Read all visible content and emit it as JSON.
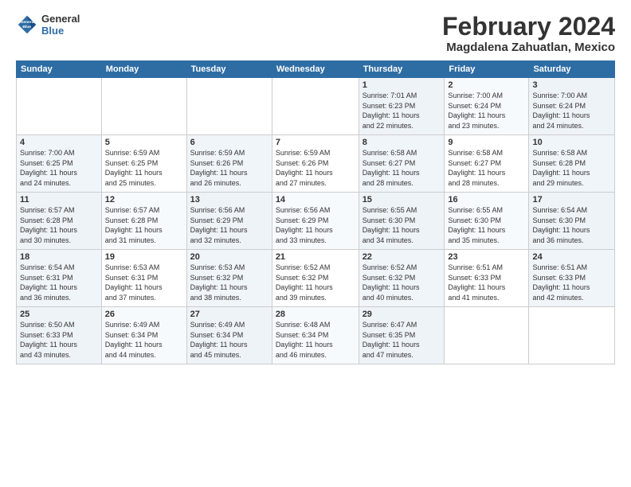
{
  "header": {
    "logo_line1": "General",
    "logo_line2": "Blue",
    "title": "February 2024",
    "subtitle": "Magdalena Zahuatlan, Mexico"
  },
  "calendar": {
    "days_of_week": [
      "Sunday",
      "Monday",
      "Tuesday",
      "Wednesday",
      "Thursday",
      "Friday",
      "Saturday"
    ],
    "weeks": [
      [
        {
          "day": "",
          "info": ""
        },
        {
          "day": "",
          "info": ""
        },
        {
          "day": "",
          "info": ""
        },
        {
          "day": "",
          "info": ""
        },
        {
          "day": "1",
          "info": "Sunrise: 7:01 AM\nSunset: 6:23 PM\nDaylight: 11 hours\nand 22 minutes."
        },
        {
          "day": "2",
          "info": "Sunrise: 7:00 AM\nSunset: 6:24 PM\nDaylight: 11 hours\nand 23 minutes."
        },
        {
          "day": "3",
          "info": "Sunrise: 7:00 AM\nSunset: 6:24 PM\nDaylight: 11 hours\nand 24 minutes."
        }
      ],
      [
        {
          "day": "4",
          "info": "Sunrise: 7:00 AM\nSunset: 6:25 PM\nDaylight: 11 hours\nand 24 minutes."
        },
        {
          "day": "5",
          "info": "Sunrise: 6:59 AM\nSunset: 6:25 PM\nDaylight: 11 hours\nand 25 minutes."
        },
        {
          "day": "6",
          "info": "Sunrise: 6:59 AM\nSunset: 6:26 PM\nDaylight: 11 hours\nand 26 minutes."
        },
        {
          "day": "7",
          "info": "Sunrise: 6:59 AM\nSunset: 6:26 PM\nDaylight: 11 hours\nand 27 minutes."
        },
        {
          "day": "8",
          "info": "Sunrise: 6:58 AM\nSunset: 6:27 PM\nDaylight: 11 hours\nand 28 minutes."
        },
        {
          "day": "9",
          "info": "Sunrise: 6:58 AM\nSunset: 6:27 PM\nDaylight: 11 hours\nand 28 minutes."
        },
        {
          "day": "10",
          "info": "Sunrise: 6:58 AM\nSunset: 6:28 PM\nDaylight: 11 hours\nand 29 minutes."
        }
      ],
      [
        {
          "day": "11",
          "info": "Sunrise: 6:57 AM\nSunset: 6:28 PM\nDaylight: 11 hours\nand 30 minutes."
        },
        {
          "day": "12",
          "info": "Sunrise: 6:57 AM\nSunset: 6:28 PM\nDaylight: 11 hours\nand 31 minutes."
        },
        {
          "day": "13",
          "info": "Sunrise: 6:56 AM\nSunset: 6:29 PM\nDaylight: 11 hours\nand 32 minutes."
        },
        {
          "day": "14",
          "info": "Sunrise: 6:56 AM\nSunset: 6:29 PM\nDaylight: 11 hours\nand 33 minutes."
        },
        {
          "day": "15",
          "info": "Sunrise: 6:55 AM\nSunset: 6:30 PM\nDaylight: 11 hours\nand 34 minutes."
        },
        {
          "day": "16",
          "info": "Sunrise: 6:55 AM\nSunset: 6:30 PM\nDaylight: 11 hours\nand 35 minutes."
        },
        {
          "day": "17",
          "info": "Sunrise: 6:54 AM\nSunset: 6:30 PM\nDaylight: 11 hours\nand 36 minutes."
        }
      ],
      [
        {
          "day": "18",
          "info": "Sunrise: 6:54 AM\nSunset: 6:31 PM\nDaylight: 11 hours\nand 36 minutes."
        },
        {
          "day": "19",
          "info": "Sunrise: 6:53 AM\nSunset: 6:31 PM\nDaylight: 11 hours\nand 37 minutes."
        },
        {
          "day": "20",
          "info": "Sunrise: 6:53 AM\nSunset: 6:32 PM\nDaylight: 11 hours\nand 38 minutes."
        },
        {
          "day": "21",
          "info": "Sunrise: 6:52 AM\nSunset: 6:32 PM\nDaylight: 11 hours\nand 39 minutes."
        },
        {
          "day": "22",
          "info": "Sunrise: 6:52 AM\nSunset: 6:32 PM\nDaylight: 11 hours\nand 40 minutes."
        },
        {
          "day": "23",
          "info": "Sunrise: 6:51 AM\nSunset: 6:33 PM\nDaylight: 11 hours\nand 41 minutes."
        },
        {
          "day": "24",
          "info": "Sunrise: 6:51 AM\nSunset: 6:33 PM\nDaylight: 11 hours\nand 42 minutes."
        }
      ],
      [
        {
          "day": "25",
          "info": "Sunrise: 6:50 AM\nSunset: 6:33 PM\nDaylight: 11 hours\nand 43 minutes."
        },
        {
          "day": "26",
          "info": "Sunrise: 6:49 AM\nSunset: 6:34 PM\nDaylight: 11 hours\nand 44 minutes."
        },
        {
          "day": "27",
          "info": "Sunrise: 6:49 AM\nSunset: 6:34 PM\nDaylight: 11 hours\nand 45 minutes."
        },
        {
          "day": "28",
          "info": "Sunrise: 6:48 AM\nSunset: 6:34 PM\nDaylight: 11 hours\nand 46 minutes."
        },
        {
          "day": "29",
          "info": "Sunrise: 6:47 AM\nSunset: 6:35 PM\nDaylight: 11 hours\nand 47 minutes."
        },
        {
          "day": "",
          "info": ""
        },
        {
          "day": "",
          "info": ""
        }
      ]
    ]
  }
}
